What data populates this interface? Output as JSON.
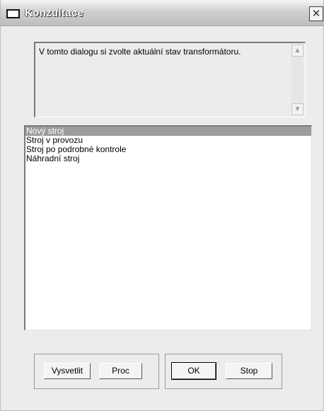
{
  "window": {
    "title": "Konzultace",
    "close_glyph": "✕"
  },
  "description": {
    "text": "V tomto dialogu si zvolte aktuální stav transformátoru.",
    "scroll_up_glyph": "▲",
    "scroll_down_glyph": "▼"
  },
  "options": {
    "items": [
      {
        "label": "Nový stroj",
        "selected": true
      },
      {
        "label": "Stroj v provozu",
        "selected": false
      },
      {
        "label": "Stroj po podrobné kontrole",
        "selected": false
      },
      {
        "label": "Náhradní stroj",
        "selected": false
      }
    ]
  },
  "buttons": {
    "explain": "Vysvetlit",
    "why": "Proc",
    "ok": "OK",
    "stop": "Stop"
  },
  "colors": {
    "selection": "#9c9c9c",
    "window_bg": "#ececec"
  }
}
